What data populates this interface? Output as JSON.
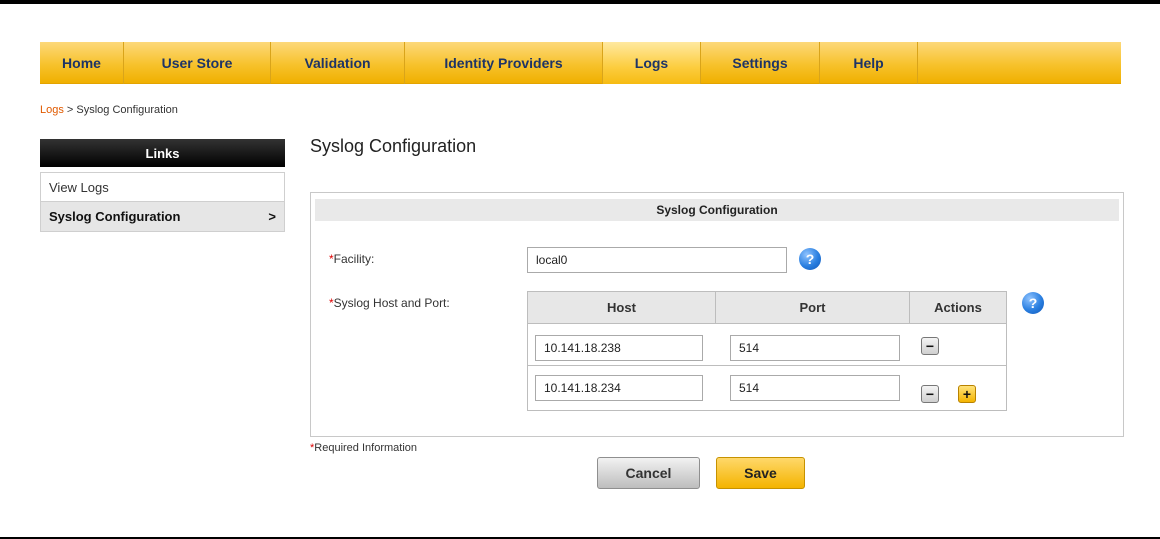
{
  "nav": {
    "items": [
      {
        "label": "Home",
        "active": false
      },
      {
        "label": "User Store",
        "active": false
      },
      {
        "label": "Validation",
        "active": false
      },
      {
        "label": "Identity Providers",
        "active": false
      },
      {
        "label": "Logs",
        "active": true
      },
      {
        "label": "Settings",
        "active": false
      },
      {
        "label": "Help",
        "active": false
      }
    ]
  },
  "breadcrumb": {
    "link": "Logs",
    "separator": " > ",
    "current": "Syslog Configuration"
  },
  "sidebar": {
    "title": "Links",
    "items": [
      {
        "label": "View Logs",
        "active": false
      },
      {
        "label": "Syslog Configuration",
        "active": true,
        "chevron": ">"
      }
    ]
  },
  "page": {
    "title": "Syslog Configuration"
  },
  "panel": {
    "header": "Syslog Configuration",
    "facility": {
      "required_mark": "*",
      "label": "Facility:",
      "value": "local0"
    },
    "hosts": {
      "required_mark": "*",
      "label": "Syslog Host and Port:",
      "columns": [
        "Host",
        "Port",
        "Actions"
      ],
      "rows": [
        {
          "host": "10.141.18.238",
          "port": "514"
        },
        {
          "host": "10.141.18.234",
          "port": "514"
        }
      ]
    }
  },
  "icons": {
    "help": "?",
    "minus": "−",
    "plus": "+"
  },
  "footer": {
    "required_mark": "*",
    "required_note": "Required Information"
  },
  "buttons": {
    "cancel": "Cancel",
    "save": "Save"
  },
  "colors": {
    "nav_gold": "#f7c22c",
    "link_orange": "#e05a00",
    "help_blue": "#2a7fe0",
    "required_red": "#dd0000"
  }
}
